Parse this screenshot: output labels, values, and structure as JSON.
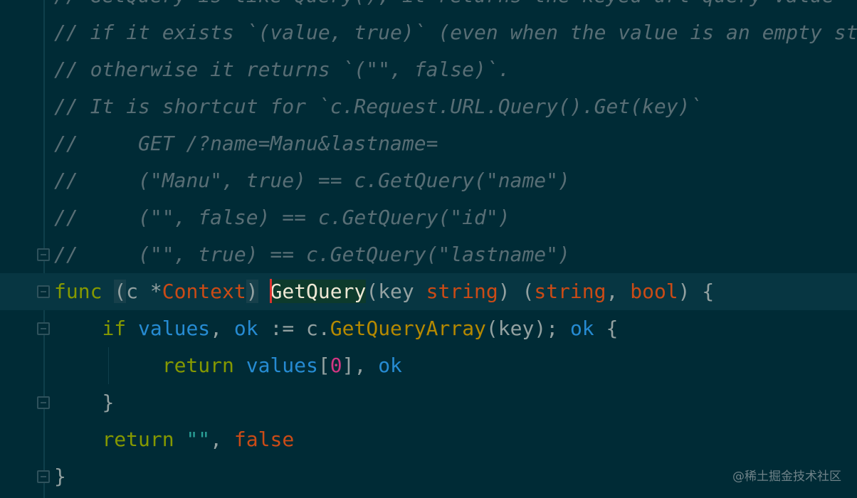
{
  "editor": {
    "lines": {
      "l0": "// GetQuery is like Query(), it returns the keyed url query value",
      "l1": "// if it exists `(value, true)` (even when the value is an empty string),",
      "l2": "// otherwise it returns `(\"\", false)`.",
      "l3": "// It is shortcut for `c.Request.URL.Query().Get(key)`",
      "l4": "//     GET /?name=Manu&lastname=",
      "l5": "//     (\"Manu\", true) == c.GetQuery(\"name\")",
      "l6": "//     (\"\", false) == c.GetQuery(\"id\")",
      "l7": "//     (\"\", true) == c.GetQuery(\"lastname\")"
    },
    "func_sig": {
      "kw_func": "func",
      "paren_open": "(",
      "receiver": "c",
      "star": " *",
      "recv_type": "Context",
      "paren_close": ")",
      "name": "GetQuery",
      "param_open": "(",
      "param": "key",
      "param_type": "string",
      "param_close": ")",
      "ret_open": " (",
      "ret1": "string",
      "comma": ",",
      "ret2": "bool",
      "ret_close": ")",
      "brace": " {"
    },
    "if_line": {
      "kw_if": "if",
      "var1": "values",
      "comma": ",",
      "var2": "ok",
      "assign": " := c.",
      "call": "GetQueryArray",
      "args": "(key); ",
      "cond": "ok",
      "brace": " {"
    },
    "return_line": {
      "kw_return": "return",
      "var": "values",
      "bracket_open": "[",
      "index": "0",
      "bracket_close": "],",
      "ok": "ok"
    },
    "close_if": "}",
    "final_return": {
      "kw_return": "return",
      "str": "\"\"",
      "comma": ",",
      "false": "false"
    },
    "close_func": "}"
  },
  "watermark": "@稀土掘金技术社区",
  "colors": {
    "background": "#002b36",
    "current_line": "#073642",
    "comment": "#586e75",
    "keyword": "#859900",
    "type": "#cb4b16",
    "function": "#b58900",
    "identifier": "#268bd2",
    "number": "#d33682",
    "string": "#2aa198",
    "plain": "#93a1a1",
    "caret": "#dc322f"
  }
}
